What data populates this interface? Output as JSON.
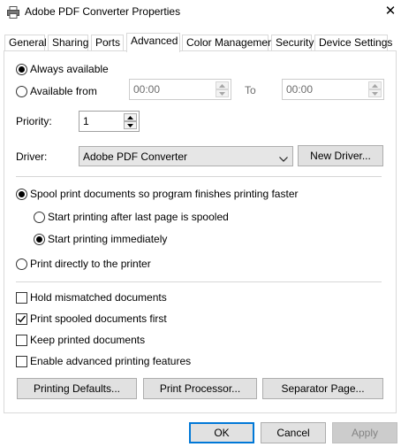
{
  "window": {
    "title": "Adobe PDF Converter Properties",
    "icon": "printer-icon",
    "close_glyph": "✕"
  },
  "tabs": [
    {
      "label": "General",
      "active": false
    },
    {
      "label": "Sharing",
      "active": false
    },
    {
      "label": "Ports",
      "active": false
    },
    {
      "label": "Advanced",
      "active": true
    },
    {
      "label": "Color Management",
      "active": false
    },
    {
      "label": "Security",
      "active": false
    },
    {
      "label": "Device Settings",
      "active": false
    }
  ],
  "availability": {
    "always_label": "Always available",
    "always_selected": true,
    "from_label": "Available from",
    "from_selected": false,
    "from_time": "00:00",
    "to_label": "To",
    "to_time": "00:00"
  },
  "priority": {
    "label": "Priority:",
    "value": "1"
  },
  "driver": {
    "label": "Driver:",
    "selected": "Adobe PDF Converter",
    "new_driver_button": "New Driver..."
  },
  "spooling": {
    "spool_label": "Spool print documents so program finishes printing faster",
    "spool_selected": true,
    "after_last_page_label": "Start printing after last page is spooled",
    "after_last_page_selected": false,
    "immediately_label": "Start printing immediately",
    "immediately_selected": true,
    "direct_label": "Print directly to the printer",
    "direct_selected": false
  },
  "options": {
    "hold_mismatched": {
      "label": "Hold mismatched documents",
      "checked": false
    },
    "print_spooled_first": {
      "label": "Print spooled documents first",
      "checked": true
    },
    "keep_printed": {
      "label": "Keep printed documents",
      "checked": false
    },
    "advanced_features": {
      "label": "Enable advanced printing features",
      "checked": false
    }
  },
  "action_buttons": {
    "printing_defaults": "Printing Defaults...",
    "print_processor": "Print Processor...",
    "separator_page": "Separator Page..."
  },
  "footer": {
    "ok": "OK",
    "cancel": "Cancel",
    "apply": "Apply",
    "apply_enabled": false
  },
  "colors": {
    "focus_border": "#0078d7",
    "button_face": "#e1e1e1",
    "disabled_text": "#838383"
  }
}
